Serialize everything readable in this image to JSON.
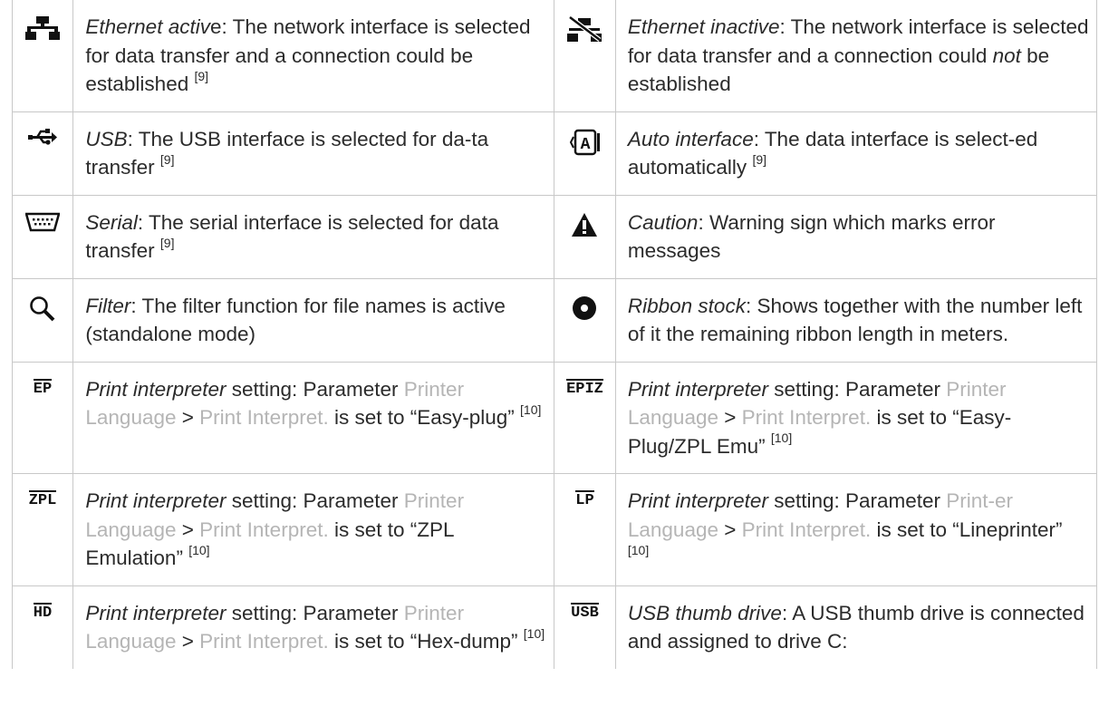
{
  "rows": [
    {
      "left": {
        "icon": "ethernet-active-icon",
        "parts": [
          {
            "t": "Ethernet activ",
            "s": "it"
          },
          {
            "t": "e: The network interface is selected for data transfer and a connection could be established ",
            "s": ""
          },
          {
            "t": "[9]",
            "s": "sup"
          }
        ]
      },
      "right": {
        "icon": "ethernet-inactive-icon",
        "parts": [
          {
            "t": "Ethernet inactive",
            "s": "it"
          },
          {
            "t": ": The network interface is selected for data transfer and a connection could ",
            "s": ""
          },
          {
            "t": "not",
            "s": "it"
          },
          {
            "t": " be established",
            "s": ""
          }
        ]
      }
    },
    {
      "left": {
        "icon": "usb-icon",
        "parts": [
          {
            "t": "USB",
            "s": "it"
          },
          {
            "t": ": The USB interface is selected for da-ta transfer  ",
            "s": ""
          },
          {
            "t": "[9]",
            "s": "sup"
          }
        ]
      },
      "right": {
        "icon": "auto-interface-icon",
        "parts": [
          {
            "t": "Auto interface",
            "s": "it"
          },
          {
            "t": ": The data interface is select-ed automatically  ",
            "s": ""
          },
          {
            "t": "[9]",
            "s": "sup"
          }
        ]
      }
    },
    {
      "left": {
        "icon": "serial-port-icon",
        "parts": [
          {
            "t": "Serial",
            "s": "it"
          },
          {
            "t": ": The serial interface is selected for data transfer  ",
            "s": ""
          },
          {
            "t": "[9]",
            "s": "sup"
          }
        ]
      },
      "right": {
        "icon": "caution-icon",
        "parts": [
          {
            "t": "Caution",
            "s": "it"
          },
          {
            "t": ": Warning sign which marks error messages",
            "s": ""
          }
        ]
      }
    },
    {
      "left": {
        "icon": "filter-icon",
        "parts": [
          {
            "t": "Filter",
            "s": "it"
          },
          {
            "t": ": The filter function for file names is active (standalone mode)",
            "s": ""
          }
        ]
      },
      "right": {
        "icon": "ribbon-stock-icon",
        "parts": [
          {
            "t": "Ribbon stock",
            "s": "it"
          },
          {
            "t": ": Shows together with the number left of it the remaining ribbon length in meters.",
            "s": ""
          }
        ]
      }
    },
    {
      "left": {
        "icon": "easyplug-icon",
        "label": "EP",
        "parts": [
          {
            "t": "Print interpreter",
            "s": "it"
          },
          {
            "t": " setting: Parameter ",
            "s": ""
          },
          {
            "t": "Printer Language",
            "s": "gray"
          },
          {
            "t": " > ",
            "s": ""
          },
          {
            "t": "Print Interpret.",
            "s": "gray"
          },
          {
            "t": " is set to “Easy-plug”  ",
            "s": ""
          },
          {
            "t": "[10]",
            "s": "sup"
          }
        ]
      },
      "right": {
        "icon": "easyplug-zpl-emu-icon",
        "label": "EPIZ",
        "parts": [
          {
            "t": "Print interpreter",
            "s": "it"
          },
          {
            "t": " setting: Parameter ",
            "s": ""
          },
          {
            "t": "Printer Language",
            "s": "gray"
          },
          {
            "t": " > ",
            "s": ""
          },
          {
            "t": "Print Interpret.",
            "s": "gray"
          },
          {
            "t": " is set to “Easy-Plug/ZPL Emu”  ",
            "s": ""
          },
          {
            "t": "[10]",
            "s": "sup"
          }
        ]
      }
    },
    {
      "left": {
        "icon": "zpl-emulation-icon",
        "label": "ZPL",
        "parts": [
          {
            "t": "Print interpreter",
            "s": "it"
          },
          {
            "t": " setting: Parameter ",
            "s": ""
          },
          {
            "t": "Printer Language",
            "s": "gray"
          },
          {
            "t": " > ",
            "s": ""
          },
          {
            "t": "Print Interpret.",
            "s": "gray"
          },
          {
            "t": " is set to “ZPL Emulation”  ",
            "s": ""
          },
          {
            "t": "[10]",
            "s": "sup"
          }
        ]
      },
      "right": {
        "icon": "lineprinter-icon",
        "label": "LP",
        "parts": [
          {
            "t": "Print interpreter",
            "s": "it"
          },
          {
            "t": " setting: Parameter ",
            "s": ""
          },
          {
            "t": "Print-er Language",
            "s": "gray"
          },
          {
            "t": " > ",
            "s": ""
          },
          {
            "t": "Print Interpret.",
            "s": "gray"
          },
          {
            "t": " is set to “Lineprinter”  ",
            "s": ""
          },
          {
            "t": "[10]",
            "s": "sup"
          }
        ]
      }
    },
    {
      "left": {
        "icon": "hexdump-icon",
        "label": "HD",
        "parts": [
          {
            "t": "Print interpreter",
            "s": "it"
          },
          {
            "t": " setting: Parameter ",
            "s": ""
          },
          {
            "t": "Printer Language",
            "s": "gray"
          },
          {
            "t": " > ",
            "s": ""
          },
          {
            "t": "Print Interpret.",
            "s": "gray"
          },
          {
            "t": " is set to “Hex-dump”  ",
            "s": ""
          },
          {
            "t": "[10]",
            "s": "sup"
          }
        ]
      },
      "right": {
        "icon": "usb-thumb-drive-icon",
        "label": "USB",
        "parts": [
          {
            "t": "USB thumb drive",
            "s": "it"
          },
          {
            "t": ": A USB thumb drive is connected and assigned to drive C:",
            "s": ""
          }
        ]
      }
    }
  ]
}
